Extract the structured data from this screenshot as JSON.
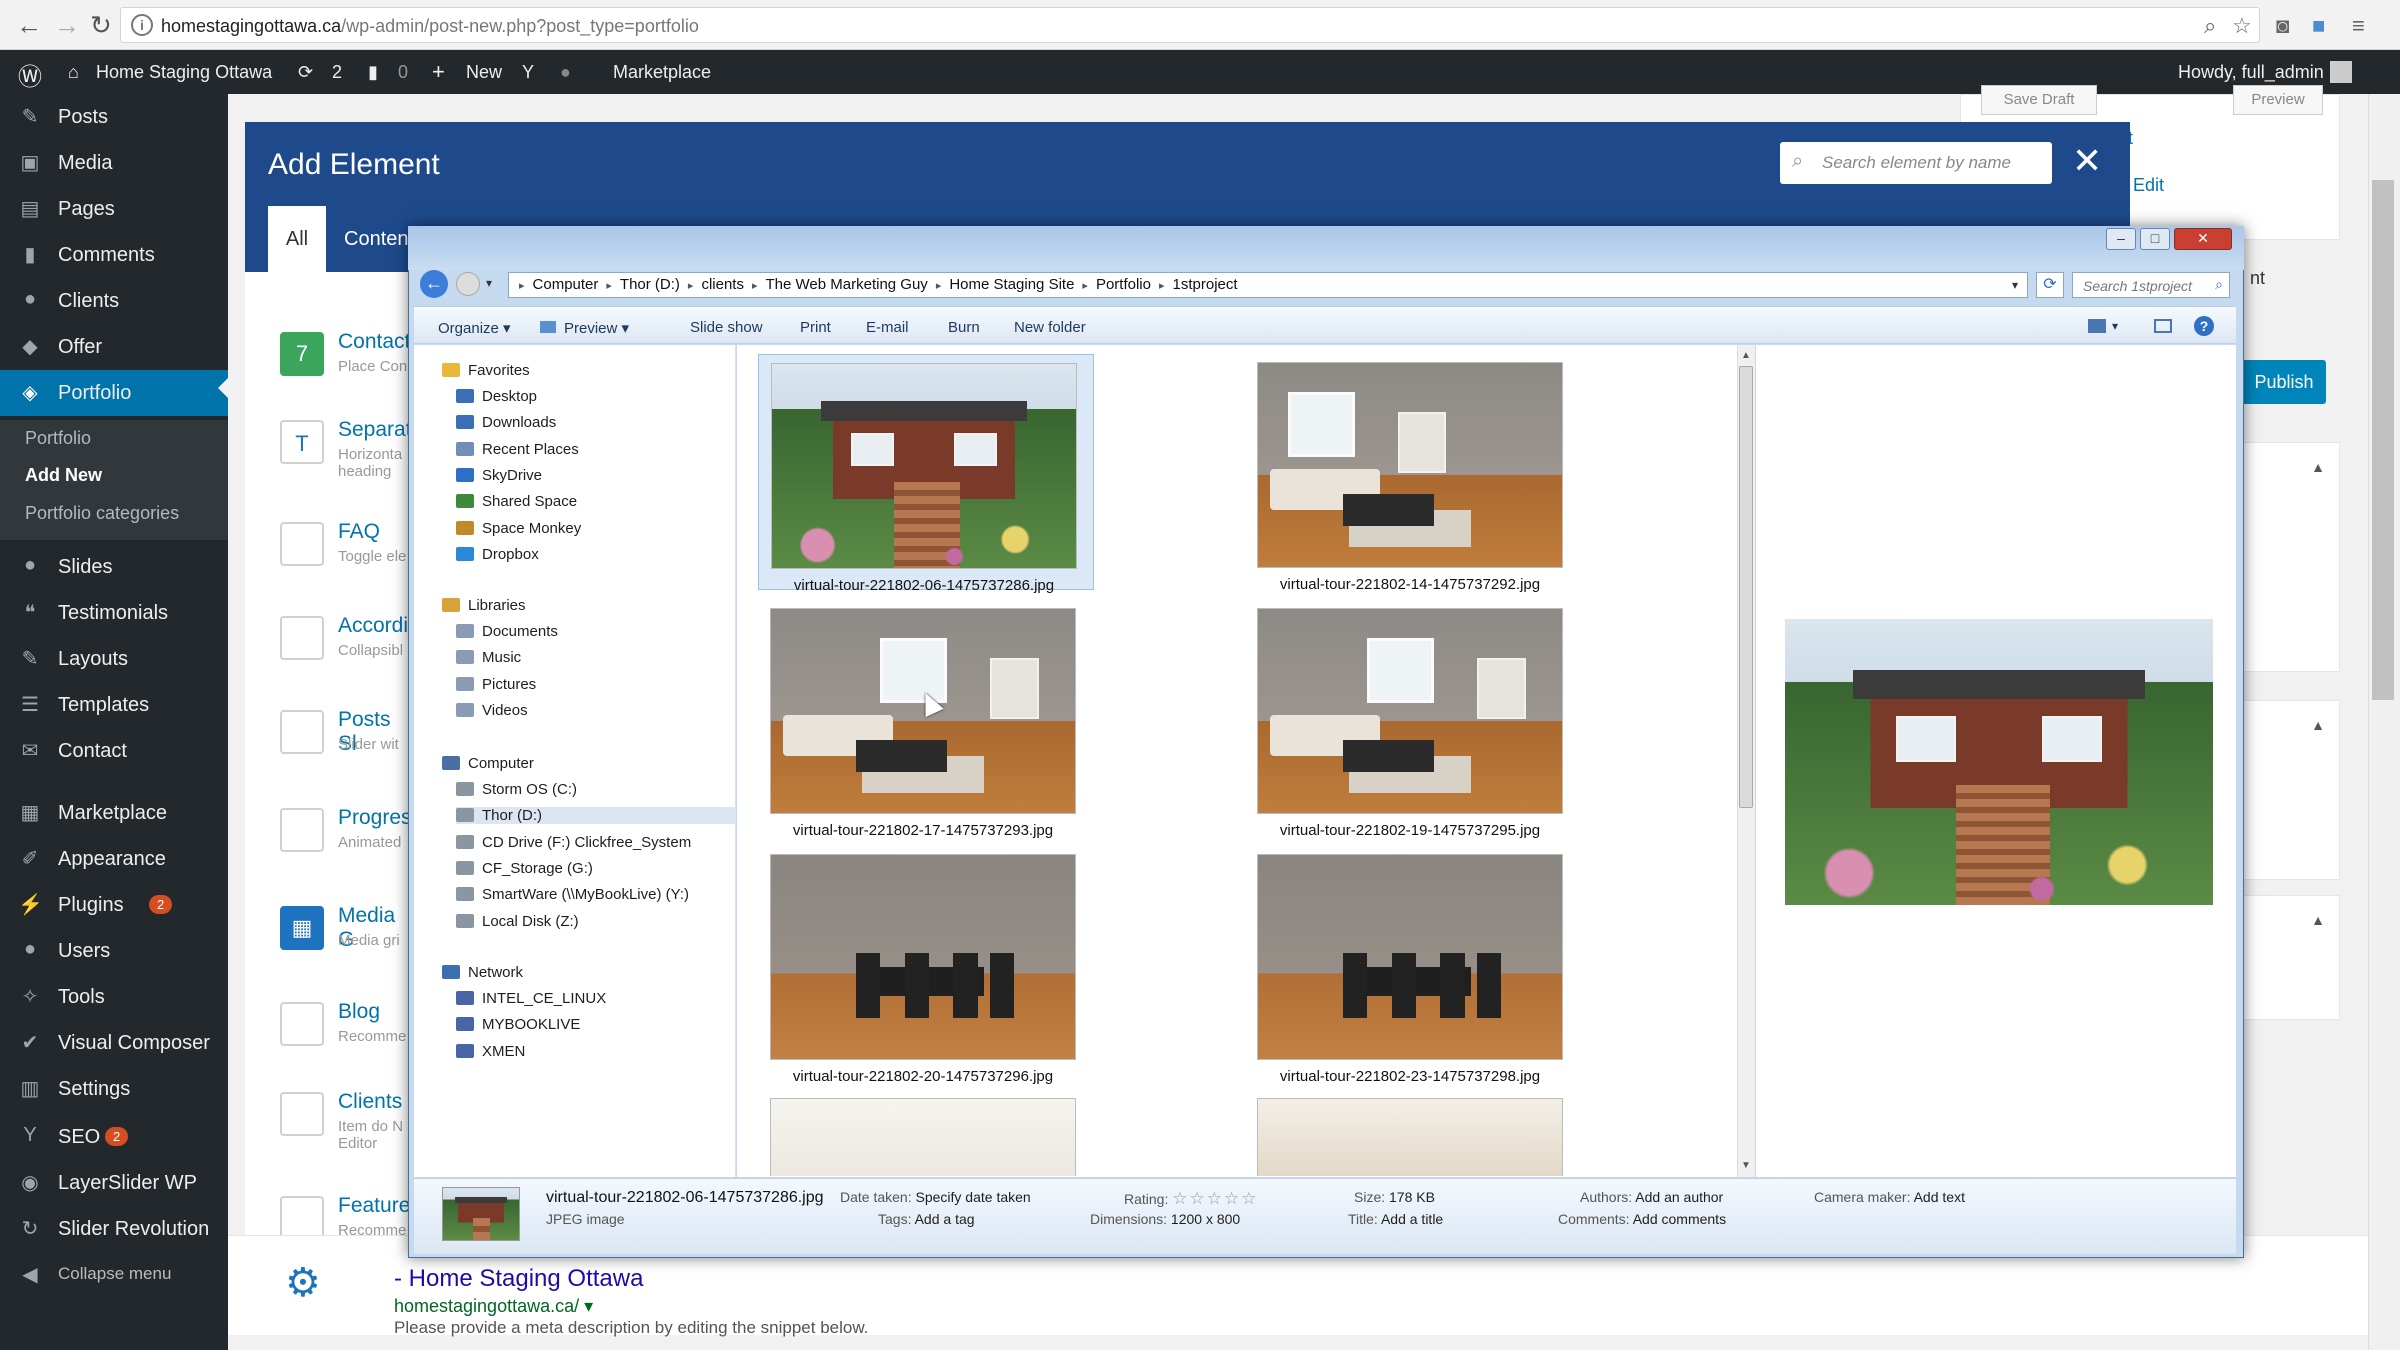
{
  "browser": {
    "url_host": "homestagingottawa.ca",
    "url_path": "/wp-admin/post-new.php?post_type=portfolio"
  },
  "adminbar": {
    "site_name": "Home Staging Ottawa",
    "updates_count": "2",
    "comments_count": "0",
    "new_label": "New",
    "marketplace_label": "Marketplace",
    "howdy": "Howdy, full_admin"
  },
  "sidebar": {
    "items": [
      {
        "label": "Posts",
        "icon": "pin-icon"
      },
      {
        "label": "Media",
        "icon": "media-icon"
      },
      {
        "label": "Pages",
        "icon": "pages-icon"
      },
      {
        "label": "Comments",
        "icon": "comments-icon"
      },
      {
        "label": "Clients",
        "icon": "clients-icon"
      },
      {
        "label": "Offer",
        "icon": "tag-icon"
      },
      {
        "label": "Portfolio",
        "icon": "portfolio-icon"
      },
      {
        "label": "Slides",
        "icon": "slides-icon"
      },
      {
        "label": "Testimonials",
        "icon": "quote-icon"
      },
      {
        "label": "Layouts",
        "icon": "pencil-icon"
      },
      {
        "label": "Templates",
        "icon": "list-icon"
      },
      {
        "label": "Contact",
        "icon": "mail-icon"
      },
      {
        "label": "Marketplace",
        "icon": "grid-icon"
      },
      {
        "label": "Appearance",
        "icon": "brush-icon"
      },
      {
        "label": "Plugins",
        "icon": "plug-icon",
        "badge": "2"
      },
      {
        "label": "Users",
        "icon": "users-icon"
      },
      {
        "label": "Tools",
        "icon": "wrench-icon"
      },
      {
        "label": "Visual Composer",
        "icon": "vc-icon"
      },
      {
        "label": "Settings",
        "icon": "settings-icon"
      },
      {
        "label": "SEO",
        "icon": "yoast-icon",
        "badge": "2"
      },
      {
        "label": "LayerSlider WP",
        "icon": "layers-icon"
      },
      {
        "label": "Slider Revolution",
        "icon": "refresh-icon"
      },
      {
        "label": "Collapse menu",
        "icon": "collapse-icon"
      }
    ],
    "submenu": [
      "Portfolio",
      "Add New",
      "Portfolio categories"
    ]
  },
  "add_element": {
    "title": "Add Element",
    "search_placeholder": "Search element by name",
    "tabs": [
      "All",
      "Conten"
    ],
    "items": [
      {
        "title": "Contact",
        "desc": "Place Con",
        "color": "#3ca55c",
        "glyph": "7"
      },
      {
        "title": "Separat",
        "desc": "Horizonta heading",
        "color": "#ffffff",
        "glyph": "T"
      },
      {
        "title": "FAQ",
        "desc": "Toggle ele",
        "color": "#ffffff",
        "glyph": ""
      },
      {
        "title": "Accordi",
        "desc": "Collapsibl",
        "color": "#ffffff",
        "glyph": ""
      },
      {
        "title": "Posts Sl",
        "desc": "Slider wit",
        "color": "#ffffff",
        "glyph": ""
      },
      {
        "title": "Progres",
        "desc": "Animated",
        "color": "#ffffff",
        "glyph": ""
      },
      {
        "title": "Media G",
        "desc": "Media gri",
        "color": "#1e73be",
        "glyph": "▦"
      },
      {
        "title": "Blog",
        "desc": "Recomme",
        "color": "#ffffff",
        "glyph": ""
      },
      {
        "title": "Clients",
        "desc": "Item do N Editor",
        "color": "#ffffff",
        "glyph": ""
      },
      {
        "title": "Feature",
        "desc": "Recomme",
        "color": "#ffffff",
        "glyph": ""
      }
    ]
  },
  "right_panel": {
    "save_draft": "Save Draft",
    "preview": "Preview",
    "edit1": "t",
    "edit2": "Edit",
    "nt": "nt",
    "publish": "Publish"
  },
  "seo_snippet": {
    "title": "- Home Staging Ottawa",
    "url": "homestagingottawa.ca/ ▾",
    "desc": "Please provide a meta description by editing the snippet below."
  },
  "explorer": {
    "path": [
      "Computer",
      "Thor (D:)",
      "clients",
      "The Web Marketing Guy",
      "Home Staging Site",
      "Portfolio",
      "1stproject"
    ],
    "search_placeholder": "Search 1stproject",
    "toolbar": [
      "Organize ▾",
      "Preview ▾",
      "Slide show",
      "Print",
      "E-mail",
      "Burn",
      "New folder"
    ],
    "nav": {
      "favorites_label": "Favorites",
      "favorites": [
        "Desktop",
        "Downloads",
        "Recent Places",
        "SkyDrive",
        "Shared Space",
        "Space Monkey",
        "Dropbox"
      ],
      "libraries_label": "Libraries",
      "libraries": [
        "Documents",
        "Music",
        "Pictures",
        "Videos"
      ],
      "computer_label": "Computer",
      "computer": [
        "Storm OS (C:)",
        "Thor (D:)",
        "CD Drive (F:) Clickfree_System",
        "CF_Storage (G:)",
        "SmartWare (\\\\MyBookLive) (Y:)",
        "Local Disk (Z:)"
      ],
      "network_label": "Network",
      "network": [
        "INTEL_CE_LINUX",
        "MYBOOKLIVE",
        "XMEN"
      ]
    },
    "files": [
      "virtual-tour-221802-06-1475737286.jpg",
      "virtual-tour-221802-14-1475737292.jpg",
      "virtual-tour-221802-17-1475737293.jpg",
      "virtual-tour-221802-19-1475737295.jpg",
      "virtual-tour-221802-20-1475737296.jpg",
      "virtual-tour-221802-23-1475737298.jpg"
    ],
    "details": {
      "filename": "virtual-tour-221802-06-1475737286.jpg",
      "filetype": "JPEG image",
      "date_taken_label": "Date taken:",
      "date_taken_value": "Specify date taken",
      "tags_label": "Tags:",
      "tags_value": "Add a tag",
      "rating_label": "Rating:",
      "rating_stars": "☆☆☆☆☆",
      "dimensions_label": "Dimensions:",
      "dimensions_value": "1200 x 800",
      "size_label": "Size:",
      "size_value": "178 KB",
      "title_label": "Title:",
      "title_value": "Add a title",
      "authors_label": "Authors:",
      "authors_value": "Add an author",
      "comments_label": "Comments:",
      "comments_value": "Add comments",
      "camera_label": "Camera maker:",
      "camera_value": "Add text"
    }
  }
}
